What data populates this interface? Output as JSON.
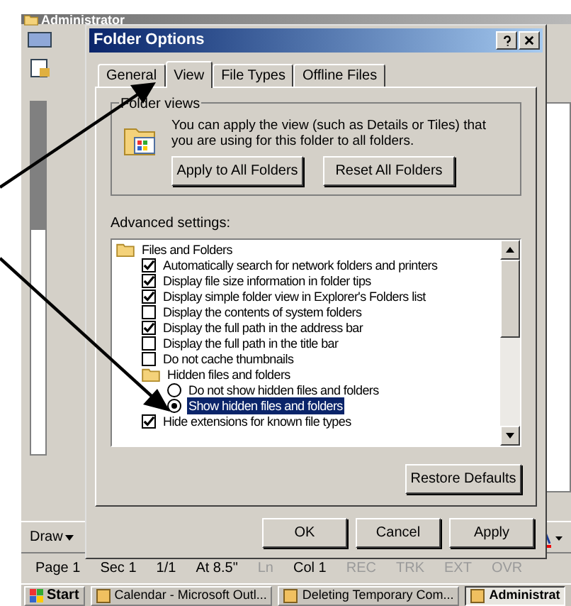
{
  "explorer_window": {
    "title": "Administrator"
  },
  "dialog": {
    "title": "Folder Options",
    "tabs": [
      {
        "label": "General",
        "selected": false
      },
      {
        "label": "View",
        "selected": true
      },
      {
        "label": "File Types",
        "selected": false
      },
      {
        "label": "Offline Files",
        "selected": false
      }
    ],
    "folder_views": {
      "legend": "Folder views",
      "description": "You can apply the view (such as Details or Tiles) that you are using for this folder to all folders.",
      "buttons": [
        "Apply to All Folders",
        "Reset All Folders"
      ]
    },
    "advanced_settings": {
      "label": "Advanced settings:",
      "items": [
        {
          "kind": "folder",
          "label": "Files and Folders",
          "children": [
            {
              "kind": "checkbox",
              "label": "Automatically search for network folders and printers",
              "checked": true
            },
            {
              "kind": "checkbox",
              "label": "Display file size information in folder tips",
              "checked": true
            },
            {
              "kind": "checkbox",
              "label": "Display simple folder view in Explorer's Folders list",
              "checked": true
            },
            {
              "kind": "checkbox",
              "label": "Display the contents of system folders",
              "checked": false
            },
            {
              "kind": "checkbox",
              "label": "Display the full path in the address bar",
              "checked": true
            },
            {
              "kind": "checkbox",
              "label": "Display the full path in the title bar",
              "checked": false
            },
            {
              "kind": "checkbox",
              "label": "Do not cache thumbnails",
              "checked": false
            },
            {
              "kind": "folder",
              "label": "Hidden files and folders",
              "children": [
                {
                  "kind": "radio",
                  "label": "Do not show hidden files and folders",
                  "checked": false,
                  "selected": false
                },
                {
                  "kind": "radio",
                  "label": "Show hidden files and folders",
                  "checked": true,
                  "selected": true
                }
              ]
            },
            {
              "kind": "checkbox",
              "label": "Hide extensions for known file types",
              "checked": true
            }
          ]
        }
      ]
    },
    "restore_button": "Restore Defaults",
    "buttons": [
      "OK",
      "Cancel",
      "Apply"
    ]
  },
  "draw_toolbar": {
    "draw_menu": "Draw"
  },
  "status_bar": [
    {
      "text": "Page 1",
      "disabled": false
    },
    {
      "text": "Sec 1",
      "disabled": false
    },
    {
      "text": "1/1",
      "disabled": false
    },
    {
      "text": "At 8.5\"",
      "disabled": false
    },
    {
      "text": "Ln",
      "disabled": true
    },
    {
      "text": "Col 1",
      "disabled": false
    },
    {
      "text": "REC",
      "disabled": true
    },
    {
      "text": "TRK",
      "disabled": true
    },
    {
      "text": "EXT",
      "disabled": true
    },
    {
      "text": "OVR",
      "disabled": true
    }
  ],
  "taskbar": {
    "start": "Start",
    "tasks": [
      {
        "label": "Calendar - Microsoft Outl...",
        "selected": false
      },
      {
        "label": "Deleting Temporary Com...",
        "selected": false
      },
      {
        "label": "Administrat",
        "selected": true
      }
    ]
  }
}
